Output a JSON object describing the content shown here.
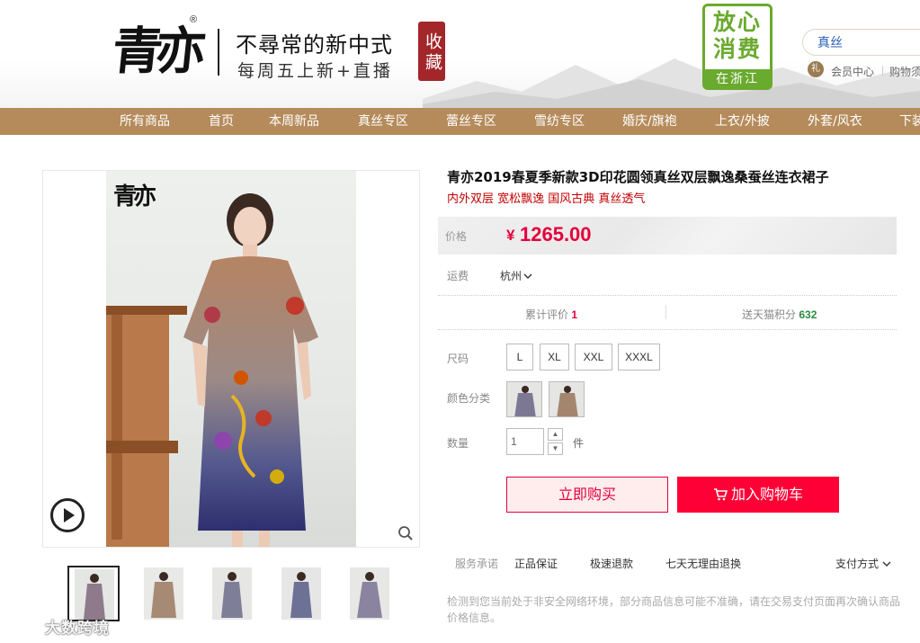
{
  "header": {
    "logo_text": "青亦",
    "logo_reg": "®",
    "slogan_line1": "不尋常的新中式",
    "slogan_line2": "每周五上新+直播",
    "seal_text": "收藏",
    "badge_top": "放心消费",
    "badge_bottom": "在浙江",
    "search_value": "真丝",
    "member_icon_text": "礼",
    "member_link": "会员中心",
    "cart_link": "购物须知"
  },
  "nav": {
    "items": [
      "所有商品",
      "首页",
      "本周新品",
      "真丝专区",
      "蕾丝专区",
      "雪纺专区",
      "婚庆/旗袍",
      "上衣/外披",
      "外套/风衣",
      "下装"
    ]
  },
  "gallery": {
    "photo_logo": "青亦",
    "thumb_count": 5
  },
  "product": {
    "title": "青亦2019春夏季新款3D印花圆领真丝双层飘逸桑蚕丝连衣裙子",
    "subtitle": "内外双层 宽松飘逸 国风古典 真丝透气",
    "price_label": "价格",
    "currency": "¥",
    "price": "1265.00",
    "shipping_label": "运费",
    "shipping_city": "杭州",
    "reviews_label": "累计评价",
    "reviews_count": "1",
    "points_label": "送天猫积分",
    "points_value": "632",
    "size_label": "尺码",
    "sizes": [
      "L",
      "XL",
      "XXL",
      "XXXL"
    ],
    "color_label": "颜色分类",
    "qty_label": "数量",
    "qty_value": "1",
    "qty_unit": "件",
    "buy_now": "立即购买",
    "add_to_cart": "加入购物车"
  },
  "service": {
    "label": "服务承诺",
    "items": [
      "正品保证",
      "极速退款",
      "七天无理由退换"
    ],
    "payment": "支付方式"
  },
  "notice": "检测到您当前处于非安全网络环境，部分商品信息可能不准确，请在交易支付页面再次确认商品价格信息。",
  "watermark": "大数跨境",
  "colors": {
    "nav_bg": "#b58b5b",
    "price_red": "#e4003c",
    "cart_red": "#ff0036",
    "badge_green": "#6aaa2e",
    "seal_red": "#a3262a"
  }
}
